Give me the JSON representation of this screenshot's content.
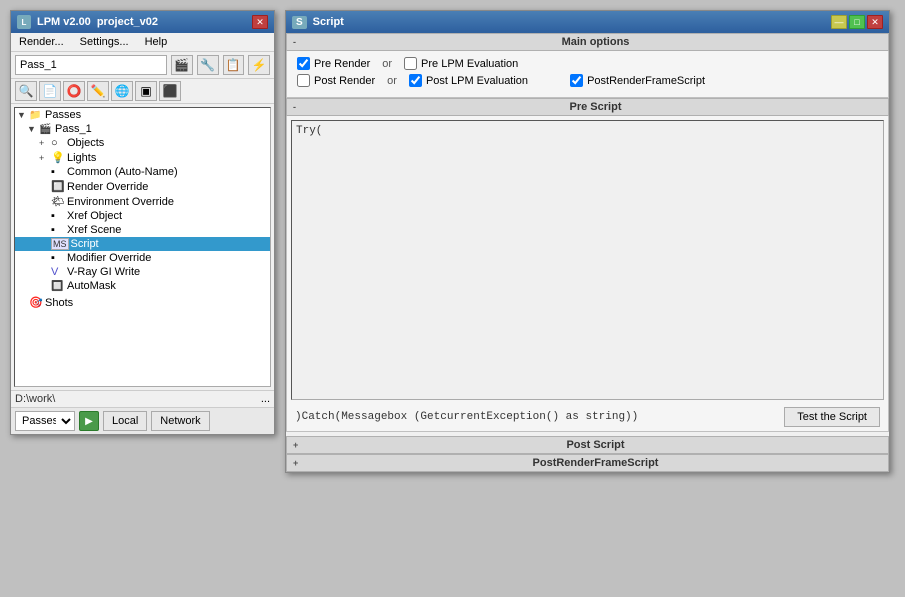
{
  "lpm": {
    "title": "LPM v2.00",
    "project": "project_v02",
    "menu": [
      "Render...",
      "Settings...",
      "Help"
    ],
    "pass_name": "Pass_1",
    "tree": [
      {
        "label": "Passes",
        "indent": 0,
        "expander": "▼",
        "icon": "📁",
        "type": "folder"
      },
      {
        "label": "Pass_1",
        "indent": 1,
        "expander": "▼",
        "icon": "🎬",
        "type": "pass"
      },
      {
        "label": "Objects",
        "indent": 2,
        "expander": "+",
        "icon": "⊕",
        "type": "objects"
      },
      {
        "label": "Lights",
        "indent": 2,
        "expander": "+",
        "icon": "⊕",
        "type": "lights"
      },
      {
        "label": "Common (Auto-Name)",
        "indent": 2,
        "expander": "",
        "icon": "▪",
        "type": "item"
      },
      {
        "label": "Render Override",
        "indent": 2,
        "expander": "",
        "icon": "▪",
        "type": "item"
      },
      {
        "label": "Environment Override",
        "indent": 2,
        "expander": "",
        "icon": "▪",
        "type": "item"
      },
      {
        "label": "Xref Object",
        "indent": 2,
        "expander": "",
        "icon": "▪",
        "type": "item"
      },
      {
        "label": "Xref Scene",
        "indent": 2,
        "expander": "",
        "icon": "▪",
        "type": "item"
      },
      {
        "label": "Script",
        "indent": 2,
        "expander": "",
        "icon": "MS",
        "type": "script",
        "selected": true
      },
      {
        "label": "Modifier Override",
        "indent": 2,
        "expander": "",
        "icon": "▪",
        "type": "item"
      },
      {
        "label": "V-Ray GI Write",
        "indent": 2,
        "expander": "",
        "icon": "▪",
        "type": "item"
      },
      {
        "label": "AutoMask",
        "indent": 2,
        "expander": "",
        "icon": "▪",
        "type": "item"
      }
    ],
    "shots_label": "Shots",
    "path": "D:\\work\\",
    "bottom_select": "Passes",
    "local_btn": "Local",
    "network_btn": "Network"
  },
  "script": {
    "title": "Script",
    "main_options": {
      "section_label": "Main options",
      "pre_render_label": "Pre Render",
      "pre_render_checked": true,
      "or1": "or",
      "pre_lpm_label": "Pre LPM Evaluation",
      "pre_lpm_checked": false,
      "post_render_label": "Post Render",
      "post_render_checked": false,
      "or2": "or",
      "post_lpm_label": "Post LPM Evaluation",
      "post_lpm_checked": true,
      "post_frame_label": "PostRenderFrameScript",
      "post_frame_checked": true
    },
    "pre_script": {
      "section_label": "Pre Script",
      "content": "Try(",
      "catch_text": ")Catch(Messagebox (GetcurrentException() as string))"
    },
    "test_btn": "Test the Script",
    "post_script": {
      "section_label": "Post Script"
    },
    "post_render_frame": {
      "section_label": "PostRenderFrameScript"
    }
  }
}
